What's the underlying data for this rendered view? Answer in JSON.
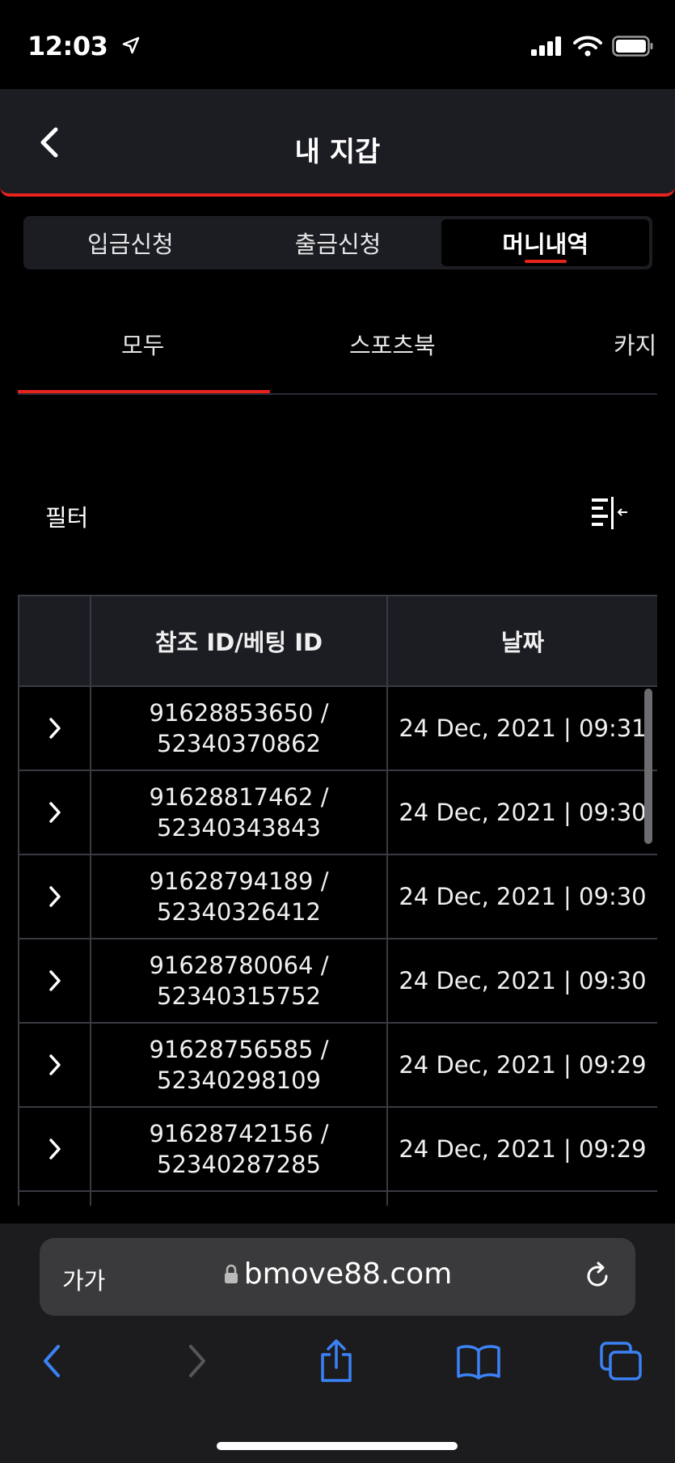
{
  "status": {
    "time": "12:03"
  },
  "header": {
    "title": "내 지갑"
  },
  "segments": [
    {
      "label": "입금신청",
      "active": false
    },
    {
      "label": "출금신청",
      "active": false
    },
    {
      "label": "머니내역",
      "active": true
    }
  ],
  "category_tabs": [
    {
      "label": "모두",
      "active": true
    },
    {
      "label": "스포츠북",
      "active": false
    },
    {
      "label": "카지",
      "active": false
    }
  ],
  "filter": {
    "label": "필터",
    "icon": "filter-collapse-icon"
  },
  "table": {
    "headers": [
      "",
      "참조 ID/베팅 ID",
      "날짜"
    ],
    "rows": [
      {
        "ref": "91628853650 /",
        "bet": "52340370862",
        "date": "24 Dec, 2021 | 09:31"
      },
      {
        "ref": "91628817462 /",
        "bet": "52340343843",
        "date": "24 Dec, 2021 | 09:30"
      },
      {
        "ref": "91628794189 /",
        "bet": "52340326412",
        "date": "24 Dec, 2021 | 09:30"
      },
      {
        "ref": "91628780064 /",
        "bet": "52340315752",
        "date": "24 Dec, 2021 | 09:30"
      },
      {
        "ref": "91628756585 /",
        "bet": "52340298109",
        "date": "24 Dec, 2021 | 09:29"
      },
      {
        "ref": "91628742156 /",
        "bet": "52340287285",
        "date": "24 Dec, 2021 | 09:29"
      }
    ]
  },
  "browser": {
    "text_size_label": "가가",
    "url": "bmove88.com"
  },
  "colors": {
    "accent": "#e8231e",
    "panel": "#1c1d22",
    "browser_blue": "#3b82f6"
  }
}
